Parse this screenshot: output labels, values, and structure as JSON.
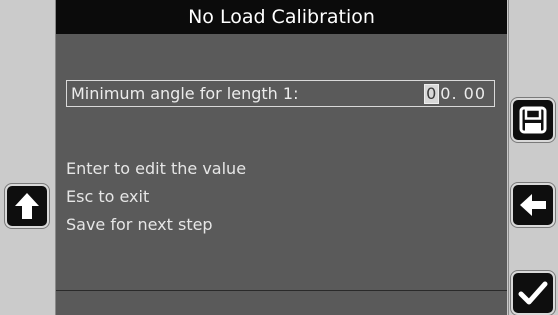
{
  "screen": {
    "title": "No Load Calibration",
    "field": {
      "label": "Minimum angle for length 1:",
      "cursor_char": "0",
      "value_rest": "0. 00"
    },
    "instructions": [
      "Enter to edit the value",
      "Esc to exit",
      "Save for next step"
    ]
  },
  "buttons": {
    "left": [
      "up-arrow-icon"
    ],
    "right": [
      "save-icon",
      "left-arrow-icon",
      "checkmark-icon"
    ]
  }
}
